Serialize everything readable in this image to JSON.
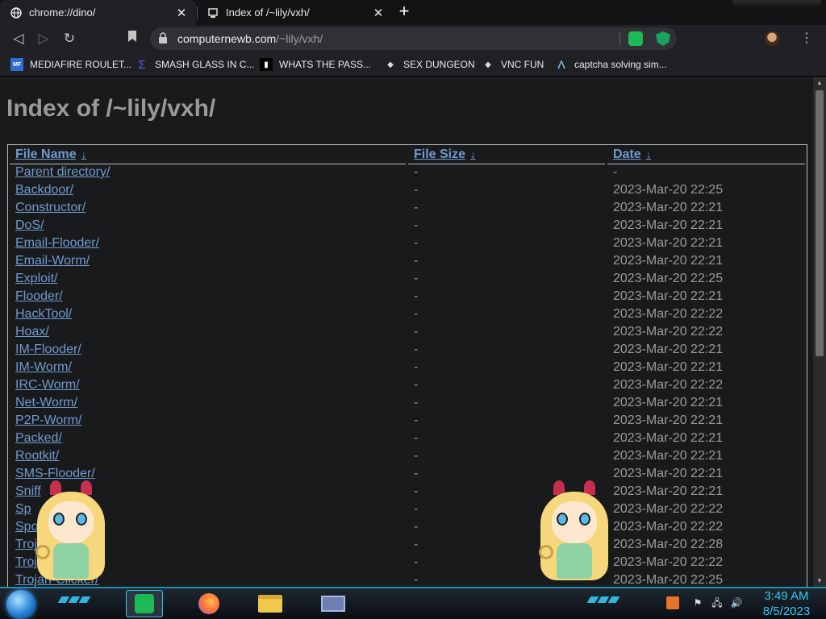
{
  "tabs": [
    {
      "title": "chrome://dino/",
      "icon": "globe-icon",
      "close": "✕"
    },
    {
      "title": "Index of /~lily/vxh/",
      "icon": "computernewb-icon",
      "close": "✕"
    }
  ],
  "new_tab_label": "+",
  "toolbar": {
    "url_host": "computernewb.com",
    "url_path": "/~lily/vxh/"
  },
  "bookmarks": [
    {
      "label": "MEDIAFIRE ROULET...",
      "icon": "mediafire-icon",
      "icon_text": "MF"
    },
    {
      "label": "SMASH GLASS IN C...",
      "icon": "sigma-icon",
      "icon_text": "Σ"
    },
    {
      "label": "WHATS THE PASS...",
      "icon": "terminal-icon",
      "icon_text": "▮"
    },
    {
      "label": "SEX DUNGEON",
      "icon": "computernewb-icon",
      "icon_text": "◆"
    },
    {
      "label": "VNC FUN",
      "icon": "computernewb-icon",
      "icon_text": "◆"
    },
    {
      "label": "captcha solving sim...",
      "icon": "lambda-icon",
      "icon_text": "Λ"
    }
  ],
  "page": {
    "title": "Index of /~lily/vxh/",
    "columns": {
      "name": "File Name",
      "size": "File Size",
      "date": "Date",
      "sort_arrow": "↓"
    },
    "rows": [
      {
        "name": "Parent directory/",
        "size": "-",
        "date": "-"
      },
      {
        "name": "Backdoor/",
        "size": "-",
        "date": "2023-Mar-20 22:25"
      },
      {
        "name": "Constructor/",
        "size": "-",
        "date": "2023-Mar-20 22:21"
      },
      {
        "name": "DoS/",
        "size": "-",
        "date": "2023-Mar-20 22:21"
      },
      {
        "name": "Email-Flooder/",
        "size": "-",
        "date": "2023-Mar-20 22:21"
      },
      {
        "name": "Email-Worm/",
        "size": "-",
        "date": "2023-Mar-20 22:21"
      },
      {
        "name": "Exploit/",
        "size": "-",
        "date": "2023-Mar-20 22:25"
      },
      {
        "name": "Flooder/",
        "size": "-",
        "date": "2023-Mar-20 22:21"
      },
      {
        "name": "HackTool/",
        "size": "-",
        "date": "2023-Mar-20 22:22"
      },
      {
        "name": "Hoax/",
        "size": "-",
        "date": "2023-Mar-20 22:22"
      },
      {
        "name": "IM-Flooder/",
        "size": "-",
        "date": "2023-Mar-20 22:21"
      },
      {
        "name": "IM-Worm/",
        "size": "-",
        "date": "2023-Mar-20 22:21"
      },
      {
        "name": "IRC-Worm/",
        "size": "-",
        "date": "2023-Mar-20 22:22"
      },
      {
        "name": "Net-Worm/",
        "size": "-",
        "date": "2023-Mar-20 22:21"
      },
      {
        "name": "P2P-Worm/",
        "size": "-",
        "date": "2023-Mar-20 22:21"
      },
      {
        "name": "Packed/",
        "size": "-",
        "date": "2023-Mar-20 22:21"
      },
      {
        "name": "Rootkit/",
        "size": "-",
        "date": "2023-Mar-20 22:21"
      },
      {
        "name": "SMS-Flooder/",
        "size": "-",
        "date": "2023-Mar-20 22:21"
      },
      {
        "name": "Sniff",
        "size": "-",
        "date": "2023-Mar-20 22:21"
      },
      {
        "name": "Sp",
        "size": "-",
        "date": "2023-Mar-20 22:22"
      },
      {
        "name": "Spoo",
        "size": "-",
        "date": "2023-Mar-20 22:22"
      },
      {
        "name": "Troj",
        "size": "-",
        "date": "2023-Mar-20 22:28"
      },
      {
        "name": "Troja",
        "size": "-",
        "date": "2023-Mar-20 22:22"
      },
      {
        "name": "Trojan-Clicker/",
        "size": "-",
        "date": "2023-Mar-20 22:25"
      }
    ]
  },
  "taskbar": {
    "apps": [
      {
        "name": "spotify-icon",
        "active": true
      },
      {
        "name": "firefox-icon",
        "active": false
      },
      {
        "name": "file-explorer-icon",
        "active": false
      },
      {
        "name": "window-icon",
        "active": false
      }
    ],
    "tray": [
      "java-icon",
      "flag-icon",
      "network-icon",
      "volume-icon"
    ],
    "time": "3:49 AM",
    "date": "8/5/2023"
  },
  "colors": {
    "link": "#6f9bd1",
    "text": "#9a9a9a",
    "accent": "#37c6f0"
  }
}
